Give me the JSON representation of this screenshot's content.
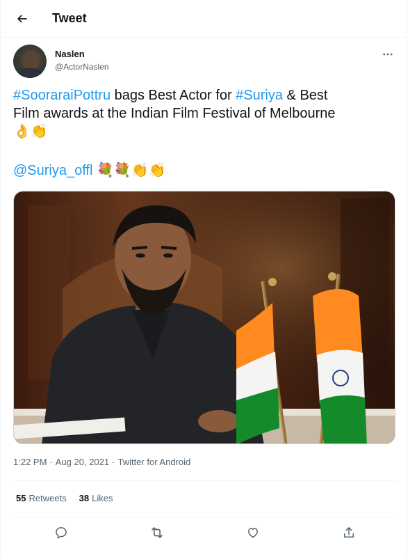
{
  "header": {
    "title": "Tweet",
    "back_icon": "arrow-left-icon"
  },
  "author": {
    "name": "Naslen",
    "handle": "@ActorNaslen",
    "more_icon": "more-horizontal-icon"
  },
  "tweet": {
    "hashtag_1": "#SoorarаiPottru",
    "text_1": " bags Best Actor for ",
    "hashtag_2": "#Suriya",
    "text_2": " & Best",
    "line_2": "Film awards at the Indian Film Festival of Melbourne",
    "emojis_1": "👌👏",
    "mention": "@Suriya_offl",
    "emojis_2": "💐💐👏👏"
  },
  "media": {
    "alt": "Photo"
  },
  "meta": {
    "time": "1:22 PM",
    "separator_1": "·",
    "date": "Aug 20, 2021",
    "separator_2": "·",
    "source": "Twitter for Android"
  },
  "stats": {
    "retweets_count": "55",
    "retweets_label": "Retweets",
    "likes_count": "38",
    "likes_label": "Likes"
  },
  "actions": {
    "reply_icon": "reply-icon",
    "retweet_icon": "retweet-icon",
    "like_icon": "heart-icon",
    "share_icon": "share-icon"
  },
  "colors": {
    "link": "#1d9bf0",
    "secondary_text": "#536471",
    "border": "#eff3f4"
  }
}
